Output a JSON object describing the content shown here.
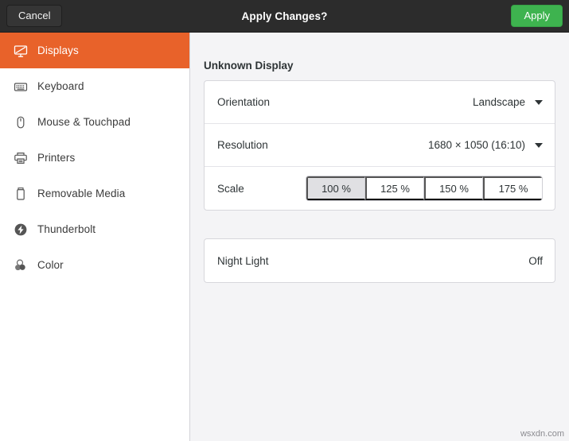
{
  "header": {
    "title": "Apply Changes?",
    "cancel_label": "Cancel",
    "apply_label": "Apply",
    "bg_color": "#2c2c2c",
    "apply_color": "#3eb34f"
  },
  "sidebar": {
    "accent_color": "#e8622a",
    "items": [
      {
        "label": "Displays",
        "icon": "display-off-icon",
        "selected": true
      },
      {
        "label": "Keyboard",
        "icon": "keyboard-icon",
        "selected": false
      },
      {
        "label": "Mouse & Touchpad",
        "icon": "mouse-icon",
        "selected": false
      },
      {
        "label": "Printers",
        "icon": "printer-icon",
        "selected": false
      },
      {
        "label": "Removable Media",
        "icon": "usb-drive-icon",
        "selected": false
      },
      {
        "label": "Thunderbolt",
        "icon": "thunderbolt-icon",
        "selected": false
      },
      {
        "label": "Color",
        "icon": "color-circles-icon",
        "selected": false
      }
    ]
  },
  "main": {
    "panel_title": "Unknown Display",
    "orientation": {
      "label": "Orientation",
      "value": "Landscape",
      "icon": "chevron-down-icon"
    },
    "resolution": {
      "label": "Resolution",
      "value": "1680 × 1050 (16:10)",
      "icon": "chevron-down-icon"
    },
    "scale": {
      "label": "Scale",
      "options": [
        "100 %",
        "125 %",
        "150 %",
        "175 %"
      ],
      "selected_index": 0
    },
    "night_light": {
      "label": "Night Light",
      "value": "Off"
    }
  },
  "watermark": "wsxdn.com"
}
